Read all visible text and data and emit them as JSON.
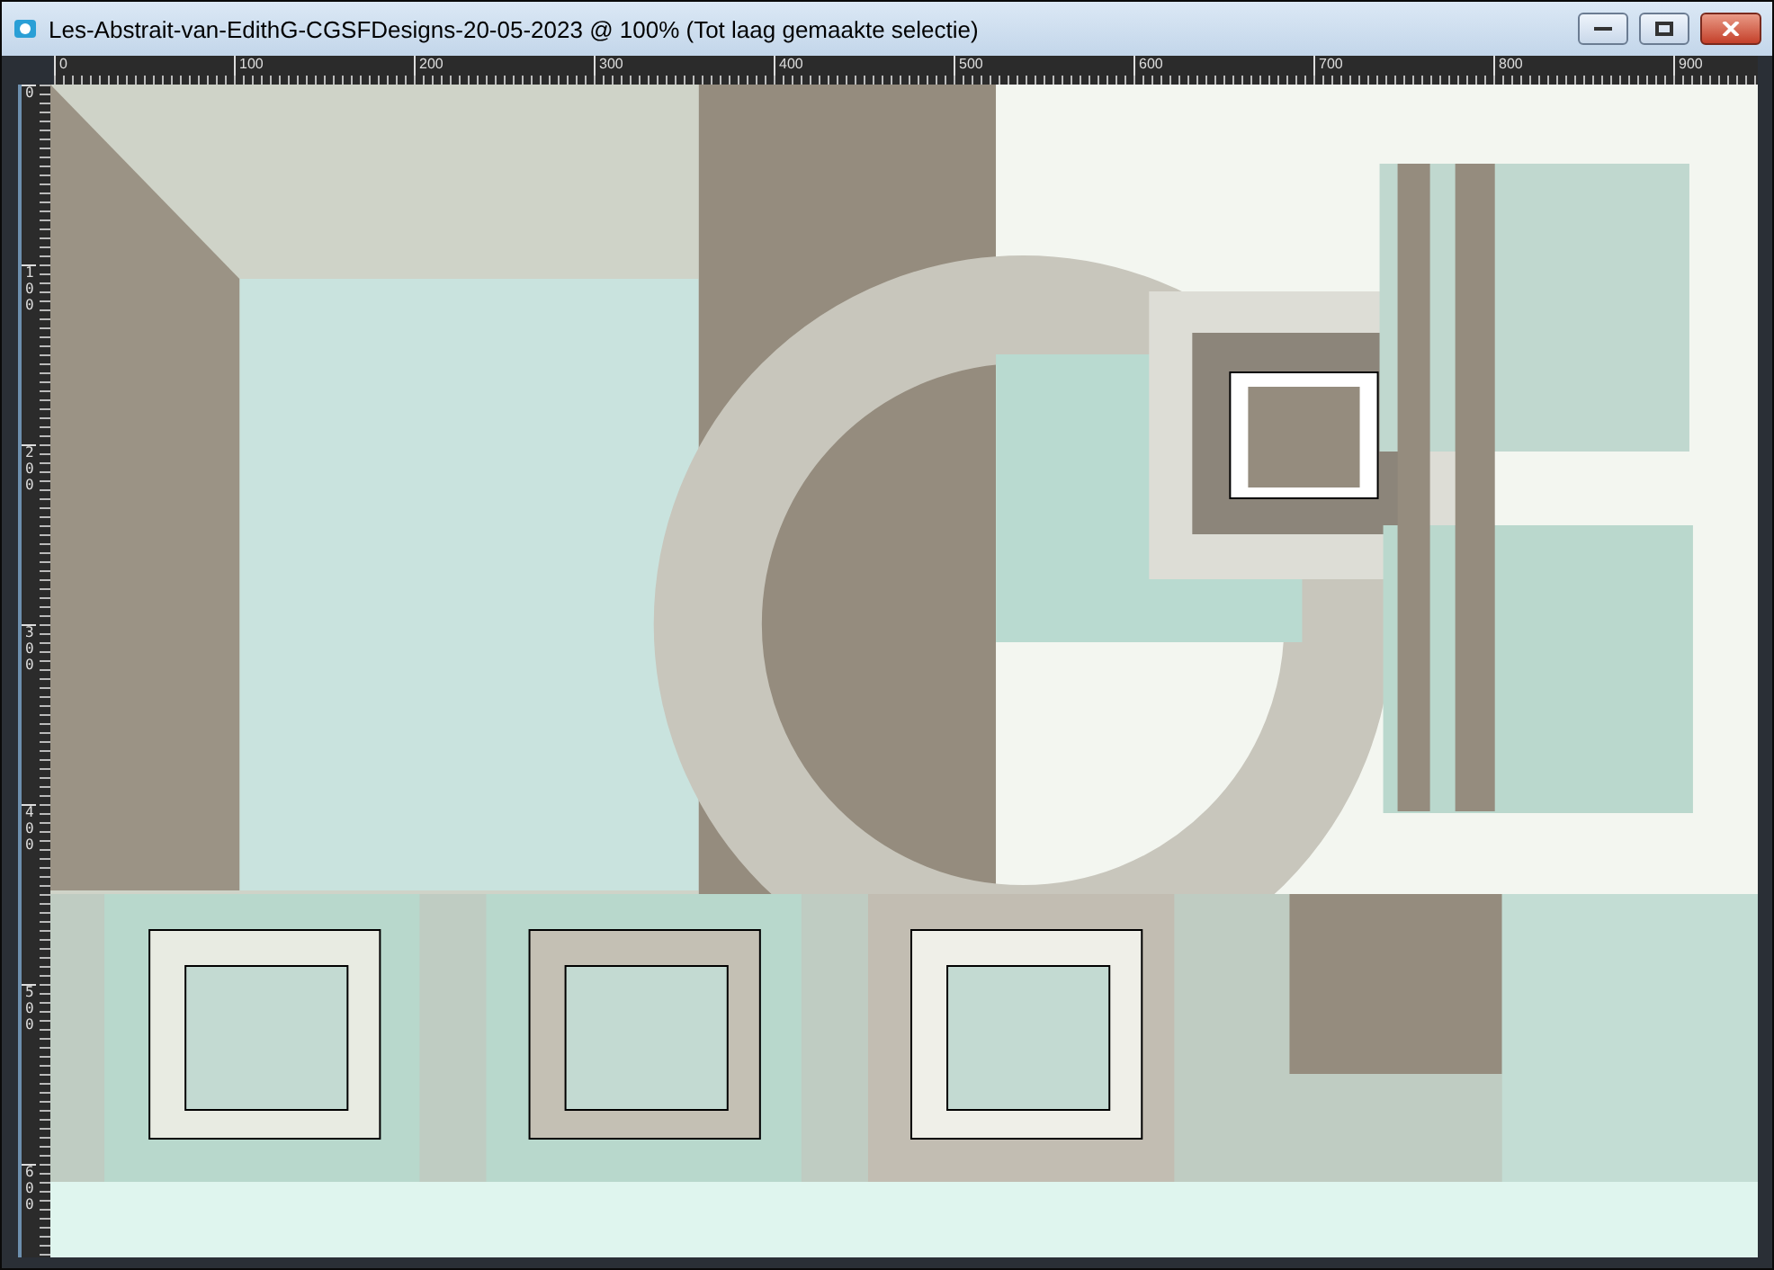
{
  "window": {
    "title": "Les-Abstrait-van-EdithG-CGSFDesigns-20-05-2023 @ 100% (Tot laag gemaakte selectie)"
  },
  "rulers": {
    "horizontal": [
      "0",
      "100",
      "200",
      "300",
      "400",
      "500",
      "600",
      "700",
      "800",
      "900"
    ],
    "vertical": [
      "0",
      "100",
      "200",
      "300",
      "400",
      "500",
      "600"
    ]
  }
}
